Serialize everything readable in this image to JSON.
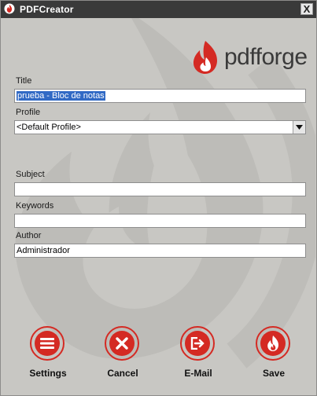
{
  "window": {
    "title": "PDFCreator",
    "close_glyph": "X"
  },
  "brand": {
    "logo_text": "pdfforge",
    "accent_color": "#d42a23"
  },
  "form": {
    "title_label": "Title",
    "title_value": "prueba - Bloc de notas",
    "profile_label": "Profile",
    "profile_value": "<Default Profile>",
    "subject_label": "Subject",
    "subject_value": "",
    "keywords_label": "Keywords",
    "keywords_value": "",
    "author_label": "Author",
    "author_value": "Administrador"
  },
  "actions": [
    {
      "label": "Settings",
      "icon": "hamburger-menu-icon"
    },
    {
      "label": "Cancel",
      "icon": "cancel-x-icon"
    },
    {
      "label": "E-Mail",
      "icon": "email-export-icon"
    },
    {
      "label": "Save",
      "icon": "flame-icon"
    }
  ]
}
